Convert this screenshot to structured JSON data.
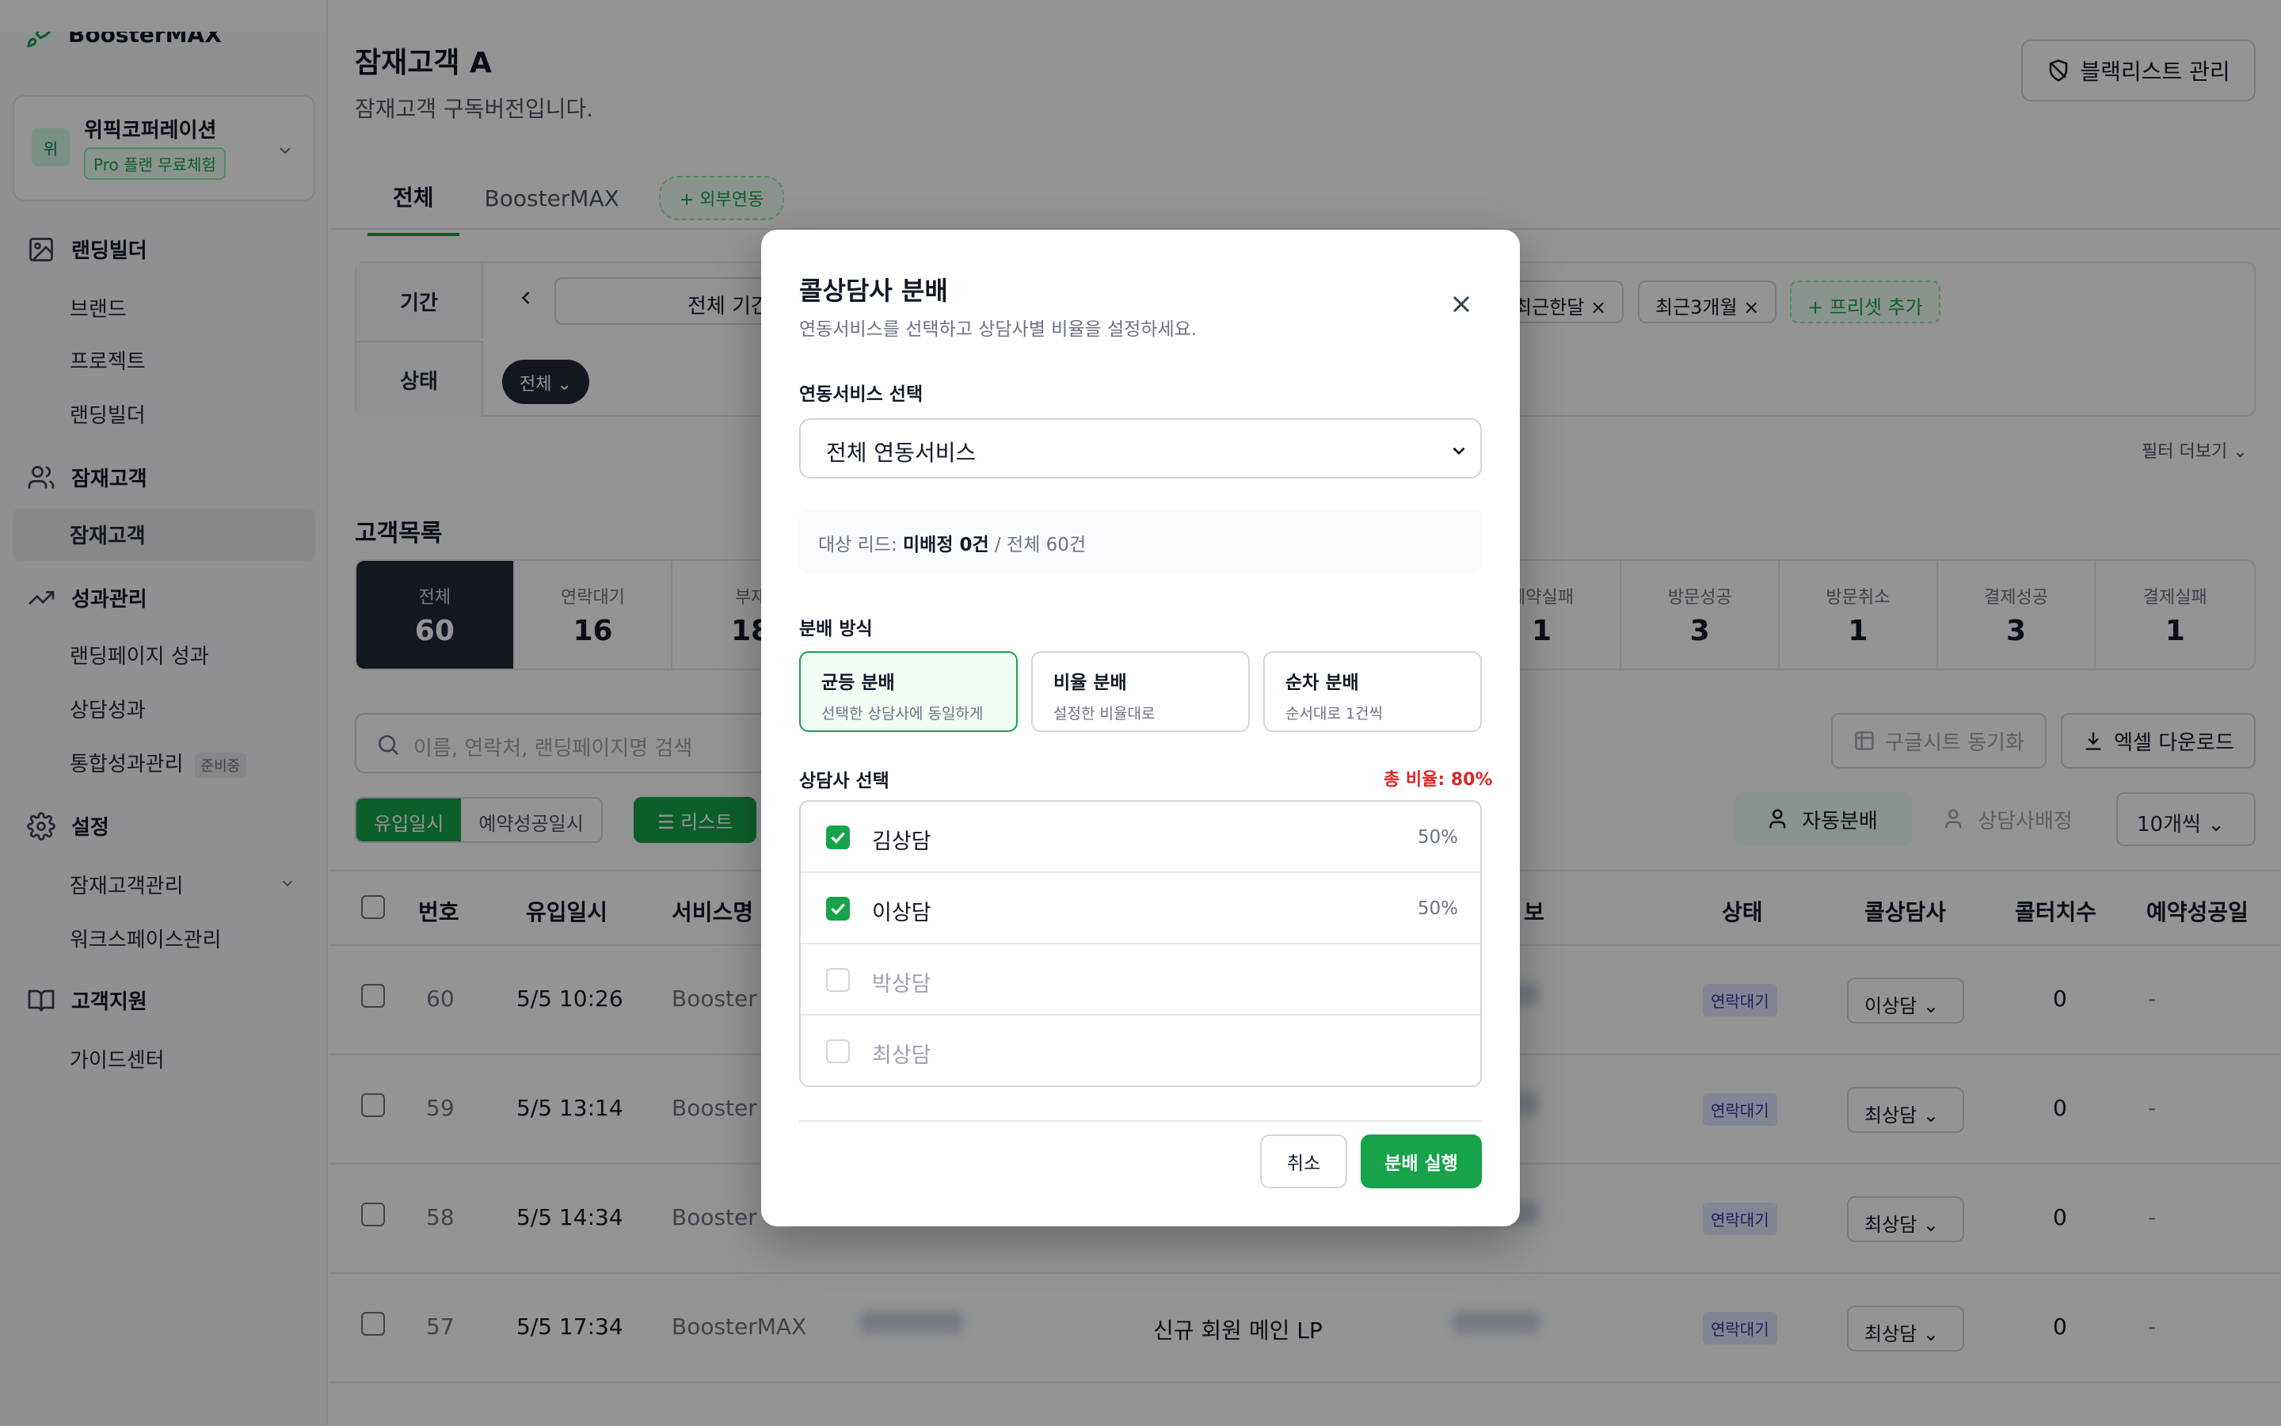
{
  "brand": {
    "name": "BoosterMAX"
  },
  "workspace": {
    "avatar": "위",
    "name": "위픽코퍼레이션",
    "plan": "Pro 플랜 무료체험"
  },
  "sidebar": {
    "groups": [
      {
        "label": "랜딩빌더",
        "icon": "image-icon",
        "items": [
          "브랜드",
          "프로젝트",
          "랜딩빌더"
        ]
      },
      {
        "label": "잠재고객",
        "icon": "users-icon",
        "items": [
          "잠재고객"
        ]
      },
      {
        "label": "성과관리",
        "icon": "trend-icon",
        "items": [
          "랜딩페이지 성과",
          "상담성과",
          "통합성과관리"
        ]
      },
      {
        "label": "설정",
        "icon": "gear-icon",
        "items": [
          "잠재고객관리",
          "워크스페이스관리"
        ]
      },
      {
        "label": "고객지원",
        "icon": "book-icon",
        "items": [
          "가이드센터"
        ]
      }
    ],
    "badge_prep": "준비중"
  },
  "page": {
    "title": "잠재고객 A",
    "subtitle": "잠재고객 구독버전입니다.",
    "blacklist_btn": "블랙리스트 관리"
  },
  "tabs": {
    "all": "전체",
    "boostermax": "BoosterMAX",
    "external": "+ 외부연동"
  },
  "filter": {
    "period_label": "기간",
    "period_value": "전체 기간",
    "status_label": "상태",
    "status_value": "전체",
    "chips": [
      "최근한달",
      "최근3개월"
    ],
    "add_preset": "+ 프리셋 추가",
    "more": "필터 더보기"
  },
  "list": {
    "title": "고객목록"
  },
  "stats": [
    {
      "label": "전체",
      "value": "60"
    },
    {
      "label": "연락대기",
      "value": "16"
    },
    {
      "label": "부재",
      "value": "18"
    },
    {
      "label": "",
      "value": ""
    },
    {
      "label": "",
      "value": ""
    },
    {
      "label": "",
      "value": ""
    },
    {
      "label": "",
      "value": ""
    },
    {
      "label": "예약실패",
      "value": "1"
    },
    {
      "label": "방문성공",
      "value": "3"
    },
    {
      "label": "방문취소",
      "value": "1"
    },
    {
      "label": "결제성공",
      "value": "3"
    },
    {
      "label": "결제실패",
      "value": "1"
    }
  ],
  "toolbar": {
    "search_placeholder": "이름, 연락처, 랜딩페이지명 검색",
    "sheet_sync": "구글시트 동기화",
    "excel": "엑셀 다운로드",
    "seg_inflow": "유입일시",
    "seg_booking": "예약성공일시",
    "list_btn": "리스트",
    "auto_dist": "자동분배",
    "assign": "상담사배정",
    "per_page": "10개씩"
  },
  "table": {
    "headers": {
      "no": "번호",
      "inflow": "유입일시",
      "service": "서비스명",
      "info": "보",
      "status": "상태",
      "counselor": "콜상담사",
      "count": "콜터치수",
      "booking": "예약성공일"
    },
    "rows": [
      {
        "no": "60",
        "date": "5/5 10:26",
        "service": "Booster",
        "landing": "",
        "status": "연락대기",
        "counselor": "이상담",
        "count": "0",
        "booking": "-"
      },
      {
        "no": "59",
        "date": "5/5 13:14",
        "service": "Booster",
        "landing": "",
        "status": "연락대기",
        "counselor": "최상담",
        "count": "0",
        "booking": "-"
      },
      {
        "no": "58",
        "date": "5/5 14:34",
        "service": "Booster",
        "landing": "",
        "status": "연락대기",
        "counselor": "최상담",
        "count": "0",
        "booking": "-"
      },
      {
        "no": "57",
        "date": "5/5 17:34",
        "service": "BoosterMAX",
        "landing": "신규 회원 메인 LP",
        "status": "연락대기",
        "counselor": "최상담",
        "count": "0",
        "booking": "-"
      }
    ]
  },
  "modal": {
    "title": "콜상담사 분배",
    "subtitle": "연동서비스를 선택하고 상담사별 비율을 설정하세요.",
    "service_label": "연동서비스 선택",
    "service_value": "전체 연동서비스",
    "target_prefix": "대상 리드:",
    "target_unassigned": "미배정 0건",
    "target_total": "/ 전체 60건",
    "method_label": "분배 방식",
    "methods": [
      {
        "title": "균등 분배",
        "desc": "선택한 상담사에 동일하게"
      },
      {
        "title": "비율 분배",
        "desc": "설정한 비율대로"
      },
      {
        "title": "순차 분배",
        "desc": "순서대로 1건씩"
      }
    ],
    "counselor_label": "상담사 선택",
    "total_ratio": "총 비율: 80%",
    "counselors": [
      {
        "name": "김상담",
        "pct": "50%",
        "checked": true
      },
      {
        "name": "이상담",
        "pct": "50%",
        "checked": true
      },
      {
        "name": "박상담",
        "pct": "",
        "checked": false
      },
      {
        "name": "최상담",
        "pct": "",
        "checked": false
      }
    ],
    "cancel": "취소",
    "run": "분배 실행"
  },
  "colors": {
    "accent": "#16a34a",
    "danger": "#dc2626",
    "dark": "#1f2937"
  }
}
